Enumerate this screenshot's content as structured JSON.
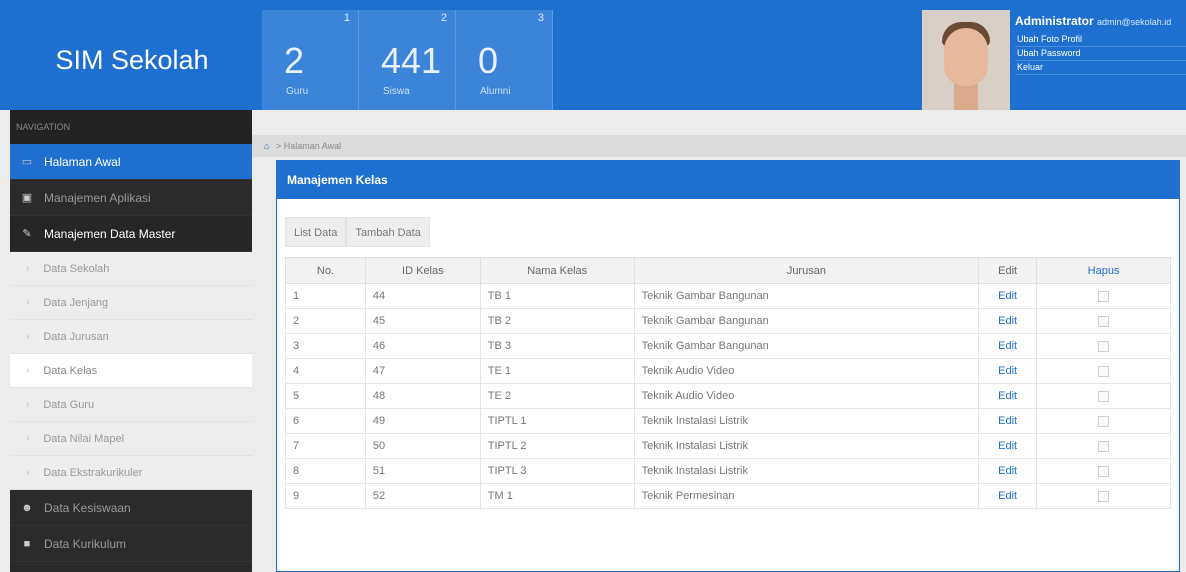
{
  "app": {
    "title": "SIM Sekolah"
  },
  "stats": [
    {
      "index": "1",
      "value": "2",
      "label": "Guru"
    },
    {
      "index": "2",
      "value": "441",
      "label": "Siswa"
    },
    {
      "index": "3",
      "value": "0",
      "label": "Alumni"
    }
  ],
  "user": {
    "name": "Administrator",
    "email": "admin@sekolah.id",
    "menu": [
      "Ubah Foto Profil",
      "Ubah Password",
      "Keluar"
    ]
  },
  "sidebar": {
    "header": "NAVIGATION",
    "items": [
      {
        "label": "Halaman Awal",
        "icon": "laptop-icon"
      },
      {
        "label": "Manajemen Aplikasi",
        "icon": "briefcase-icon"
      },
      {
        "label": "Manajemen Data Master",
        "icon": "pencil-icon"
      }
    ],
    "subitems": [
      "Data Sekolah",
      "Data Jenjang",
      "Data Jurusan",
      "Data Kelas",
      "Data Guru",
      "Data Nilai Mapel",
      "Data Ekstrakurikuler"
    ],
    "bottom_items": [
      {
        "label": "Data Kesiswaan",
        "icon": "users-icon"
      },
      {
        "label": "Data Kurikulum",
        "icon": "book-icon"
      }
    ]
  },
  "breadcrumb": {
    "text": "Halaman Awal"
  },
  "panel": {
    "title": "Manajemen Kelas",
    "tabs": [
      "List Data",
      "Tambah Data"
    ],
    "columns": [
      "No.",
      "ID Kelas",
      "Nama Kelas",
      "Jurusan",
      "Edit",
      "Hapus"
    ],
    "edit_label": "Edit",
    "rows": [
      {
        "no": "1",
        "id": "44",
        "nama": "TB 1",
        "jurusan": "Teknik Gambar Bangunan"
      },
      {
        "no": "2",
        "id": "45",
        "nama": "TB 2",
        "jurusan": "Teknik Gambar Bangunan"
      },
      {
        "no": "3",
        "id": "46",
        "nama": "TB 3",
        "jurusan": "Teknik Gambar Bangunan"
      },
      {
        "no": "4",
        "id": "47",
        "nama": "TE 1",
        "jurusan": "Teknik Audio Video"
      },
      {
        "no": "5",
        "id": "48",
        "nama": "TE 2",
        "jurusan": "Teknik Audio Video"
      },
      {
        "no": "6",
        "id": "49",
        "nama": "TIPTL 1",
        "jurusan": "Teknik Instalasi Listrik"
      },
      {
        "no": "7",
        "id": "50",
        "nama": "TIPTL 2",
        "jurusan": "Teknik Instalasi Listrik"
      },
      {
        "no": "8",
        "id": "51",
        "nama": "TIPTL 3",
        "jurusan": "Teknik Instalasi Listrik"
      },
      {
        "no": "9",
        "id": "52",
        "nama": "TM 1",
        "jurusan": "Teknik Permesinan"
      }
    ]
  }
}
